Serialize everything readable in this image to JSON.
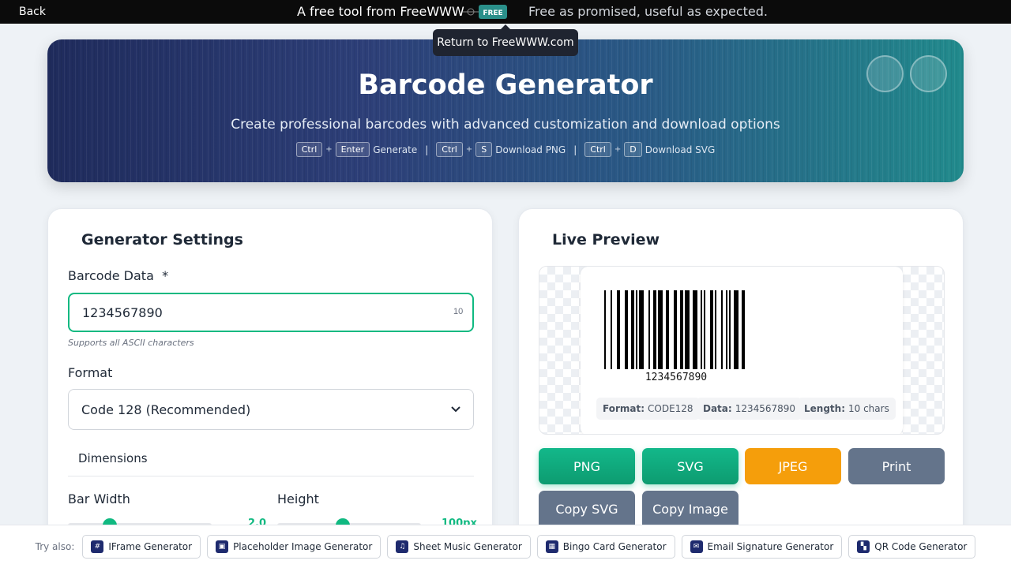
{
  "topbar": {
    "back_label": "Back",
    "promo_text": "A free tool from FreeWWW",
    "logo_text": "FREE",
    "tagline": "Free as promised, useful as expected.",
    "tooltip": "Return to FreeWWW.com"
  },
  "hero": {
    "title": "Barcode Generator",
    "subtitle": "Create professional barcodes with advanced customization and download options",
    "shortcuts": [
      {
        "keys": [
          "Ctrl",
          "Enter"
        ],
        "label": "Generate"
      },
      {
        "keys": [
          "Ctrl",
          "S"
        ],
        "label": "Download PNG"
      },
      {
        "keys": [
          "Ctrl",
          "D"
        ],
        "label": "Download SVG"
      }
    ],
    "separator": "|",
    "plus": "+"
  },
  "settings": {
    "title": "Generator Settings",
    "data_label": "Barcode Data",
    "required_mark": "*",
    "data_value": "1234567890",
    "char_count": "10",
    "hint": "Supports all ASCII characters",
    "format_label": "Format",
    "format_value": "Code 128 (Recommended)",
    "dimensions_title": "Dimensions",
    "bar_width_label": "Bar Width",
    "bar_width_value": "2.0",
    "bar_width_level": 0.27,
    "height_label": "Height",
    "height_value": "100px",
    "height_level": 0.45
  },
  "preview": {
    "title": "Live Preview",
    "barcode_text": "1234567890",
    "meta": [
      {
        "key": "Format:",
        "value": "CODE128"
      },
      {
        "key": "Data:",
        "value": "1234567890"
      },
      {
        "key": "Length:",
        "value": "10 chars"
      }
    ],
    "buttons": {
      "png": "PNG",
      "svg": "SVG",
      "jpeg": "JPEG",
      "print": "Print",
      "copy_svg": "Copy SVG",
      "copy_image": "Copy Image"
    }
  },
  "footer": {
    "try_also": "Try also:",
    "links": [
      {
        "label": "IFrame Generator",
        "icon": "hash-icon"
      },
      {
        "label": "Placeholder Image Generator",
        "icon": "image-icon"
      },
      {
        "label": "Sheet Music Generator",
        "icon": "music-icon"
      },
      {
        "label": "Bingo Card Generator",
        "icon": "grid-icon"
      },
      {
        "label": "Email Signature Generator",
        "icon": "mail-icon"
      },
      {
        "label": "QR Code Generator",
        "icon": "qr-icon"
      }
    ]
  },
  "colors": {
    "accent": "#10b981",
    "orange": "#f59e0b",
    "slate": "#64748b",
    "hero_start": "#1f2b5c",
    "hero_end": "#218a8c"
  }
}
